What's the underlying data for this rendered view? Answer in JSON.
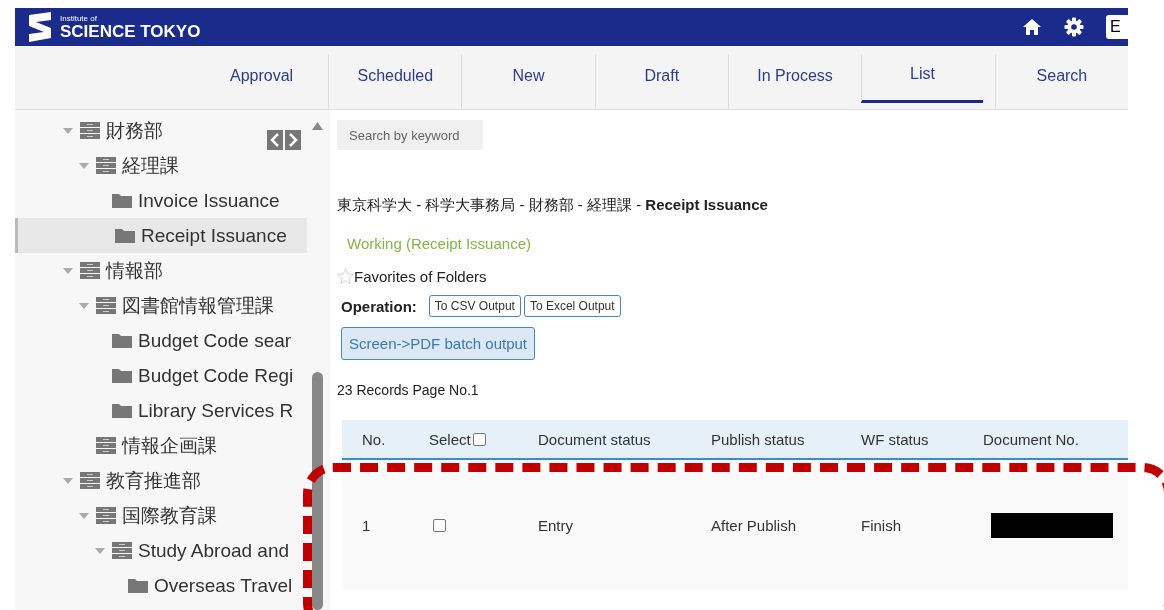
{
  "header": {
    "logo_small": "Institute of",
    "logo_main": "SCIENCE TOKYO",
    "language": "E"
  },
  "tabs": [
    {
      "label": "Approval",
      "selected": false
    },
    {
      "label": "Scheduled",
      "selected": false
    },
    {
      "label": "New",
      "selected": false
    },
    {
      "label": "Draft",
      "selected": false
    },
    {
      "label": "In Process",
      "selected": false
    },
    {
      "label": "List",
      "selected": true
    },
    {
      "label": "Search",
      "selected": false
    }
  ],
  "sidebar": {
    "tree": [
      {
        "label": "財務部",
        "kind": "department",
        "expanded": true,
        "selected": false,
        "children": [
          {
            "label": "経理課",
            "kind": "department",
            "expanded": true,
            "selected": false,
            "children": [
              {
                "label": "Invoice Issuance",
                "kind": "folder",
                "selected": false
              },
              {
                "label": "Receipt Issuance",
                "kind": "folder",
                "selected": true
              }
            ]
          }
        ]
      },
      {
        "label": "情報部",
        "kind": "department",
        "expanded": true,
        "selected": false,
        "children": [
          {
            "label": "図書館情報管理課",
            "kind": "department",
            "expanded": true,
            "selected": false,
            "children": [
              {
                "label": "Budget Code sear",
                "kind": "folder",
                "selected": false
              },
              {
                "label": "Budget Code Regi",
                "kind": "folder",
                "selected": false
              },
              {
                "label": "Library Services R",
                "kind": "folder",
                "selected": false
              }
            ]
          },
          {
            "label": "情報企画課",
            "kind": "department",
            "selected": false
          }
        ]
      },
      {
        "label": "教育推進部",
        "kind": "department",
        "expanded": true,
        "selected": false,
        "children": [
          {
            "label": "国際教育課",
            "kind": "department",
            "expanded": true,
            "selected": false,
            "children": [
              {
                "label": "Study Abroad and",
                "kind": "department",
                "expanded": true,
                "selected": false,
                "children": [
                  {
                    "label": "Overseas Travel",
                    "kind": "folder",
                    "selected": false
                  }
                ]
              }
            ]
          }
        ]
      }
    ]
  },
  "search": {
    "placeholder": "Search by keyword"
  },
  "breadcrumb": "東京科学大 - 科学大事務局 - 財務部 - 経理課 - **Receipt Issuance**",
  "working": "Working (Receipt Issuance)",
  "favorites": {
    "label": "Favorites of Folders",
    "starred": false
  },
  "operation": {
    "label": "Operation:",
    "buttons": [
      "To CSV Output",
      "To Excel Output"
    ]
  },
  "pdf_button": "Screen->PDF batch output",
  "records": "23 Records  Page No.1",
  "table": {
    "columns": [
      {
        "label": "No.",
        "kind": "text"
      },
      {
        "label": "Select",
        "kind": "checkbox",
        "checked": false
      },
      {
        "label": "Document status",
        "kind": "text"
      },
      {
        "label": "Publish status",
        "kind": "text"
      },
      {
        "label": "WF status",
        "kind": "text"
      },
      {
        "label": "Document No.",
        "kind": "text"
      }
    ],
    "rows": [
      {
        "cells": [
          "1",
          "",
          "Entry",
          "After Publish",
          "Finish",
          ""
        ],
        "checked": false,
        "document_no_redacted": true
      }
    ]
  }
}
